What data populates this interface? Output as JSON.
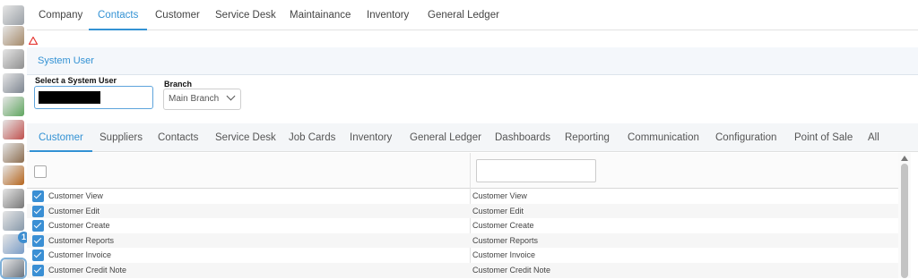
{
  "rail": {
    "icons": [
      "user-settings-icon",
      "animal-icon",
      "stakeholders-icon",
      "money-icon",
      "payments-icon",
      "invoice-icon",
      "stock-icon",
      "boxes-icon",
      "support-icon",
      "workers-icon",
      "notifications-icon",
      "camera-icon"
    ],
    "badge": "1"
  },
  "top_tabs": [
    {
      "label": "Company",
      "active": false
    },
    {
      "label": "Contacts",
      "active": true
    },
    {
      "label": "Customer",
      "active": false
    },
    {
      "label": "Service Desk",
      "active": false
    },
    {
      "label": "Maintainance",
      "active": false
    },
    {
      "label": "Inventory",
      "active": false
    },
    {
      "label": "General Ledger",
      "active": false
    }
  ],
  "section": {
    "title": "System User"
  },
  "form": {
    "system_user_label": "Select a System User",
    "system_user_value": "",
    "branch_label": "Branch",
    "branch_value": "Main Branch"
  },
  "permission_tabs": [
    {
      "label": "Customer",
      "active": true
    },
    {
      "label": "Suppliers",
      "active": false
    },
    {
      "label": "Contacts",
      "active": false
    },
    {
      "label": "Service Desk",
      "active": false
    },
    {
      "label": "Job Cards",
      "active": false
    },
    {
      "label": "Inventory",
      "active": false
    },
    {
      "label": "General Ledger",
      "active": false
    },
    {
      "label": "Dashboards",
      "active": false
    },
    {
      "label": "Reporting",
      "active": false
    },
    {
      "label": "Communication",
      "active": false
    },
    {
      "label": "Configuration",
      "active": false
    },
    {
      "label": "Point of Sale",
      "active": false
    },
    {
      "label": "All",
      "active": false
    }
  ],
  "grid": {
    "select_all_checked": false,
    "filter_value": "",
    "rows": [
      {
        "name": "Customer View",
        "description": "Customer View",
        "checked": true
      },
      {
        "name": "Customer Edit",
        "description": "Customer Edit",
        "checked": true
      },
      {
        "name": "Customer Create",
        "description": "Customer Create",
        "checked": true
      },
      {
        "name": "Customer Reports",
        "description": "Customer Reports",
        "checked": true
      },
      {
        "name": "Customer Invoice",
        "description": "Customer Invoice",
        "checked": true
      },
      {
        "name": "Customer Credit Note",
        "description": "Customer Credit Note",
        "checked": true
      }
    ]
  },
  "colors": {
    "accent": "#3392d4",
    "checkbox": "#3a8fd4",
    "warning": "#e53935"
  }
}
